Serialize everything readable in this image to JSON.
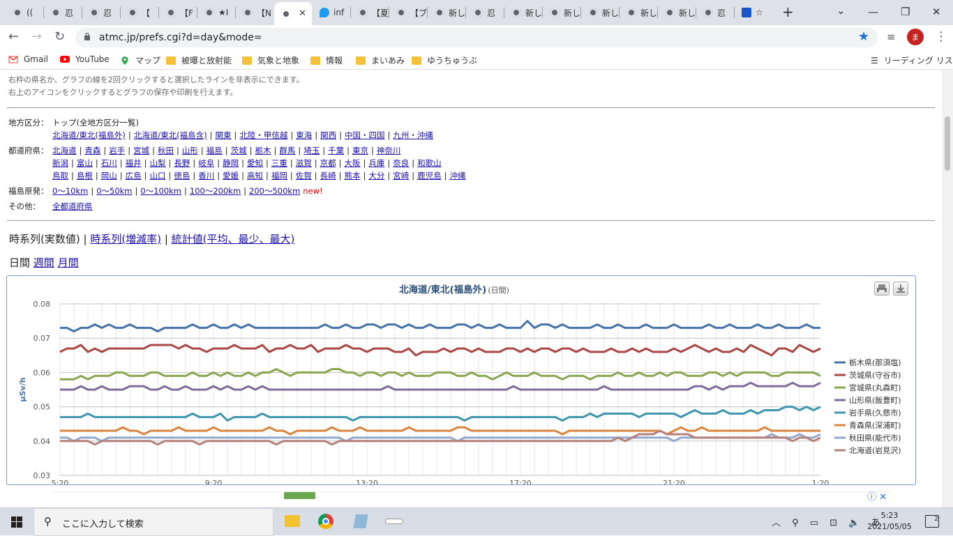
{
  "browser": {
    "tabs": [
      {
        "label": "(("
      },
      {
        "label": "忍"
      },
      {
        "label": "忍"
      },
      {
        "label": "【"
      },
      {
        "label": "【F"
      },
      {
        "label": "★I"
      },
      {
        "label": "【N"
      },
      {
        "label": "",
        "active": true
      },
      {
        "label": "inf"
      },
      {
        "label": "【夏"
      },
      {
        "label": "【ブ"
      },
      {
        "label": "新しいタ"
      },
      {
        "label": "忍"
      },
      {
        "label": "新しいタ"
      },
      {
        "label": "新しいタ"
      },
      {
        "label": "新しいタ"
      },
      {
        "label": "新しいタ"
      },
      {
        "label": "新しいタ"
      },
      {
        "label": "忍"
      },
      {
        "label": "☆"
      }
    ],
    "url": "atmc.jp/prefs.cgi?d=day&mode=",
    "avatar": "ま",
    "bookmarks": [
      {
        "label": "Gmail",
        "icon": "gmail-icon"
      },
      {
        "label": "YouTube",
        "icon": "youtube-icon"
      },
      {
        "label": "マップ",
        "icon": "maps-icon"
      },
      {
        "label": "被曝と放射能",
        "icon": "folder-icon"
      },
      {
        "label": "気象と地象",
        "icon": "folder-icon"
      },
      {
        "label": "情報",
        "icon": "folder-icon"
      },
      {
        "label": "まいあみ",
        "icon": "folder-icon"
      },
      {
        "label": "ゆうちゅうぶ",
        "icon": "folder-icon"
      }
    ],
    "reading_list": "リーディング リスト"
  },
  "page": {
    "note1": "右枠の県名か、グラフの線を2回クリックすると選択したラインを非表示にできます。",
    "note2": "右上のアイコンをクリックするとグラフの保存や印刷を行えます。",
    "region_label": "地方区分：",
    "region_top": "トップ(全地方区分一覧)",
    "regions": [
      "北海道/東北(福島外)",
      "北海道/東北(福島含)",
      "関東",
      "北陸・甲信越",
      "東海",
      "関西",
      "中国・四国",
      "九州・沖縄"
    ],
    "pref_label": "都道府県：",
    "prefs_row1": [
      "北海道",
      "青森",
      "岩手",
      "宮城",
      "秋田",
      "山形",
      "福島",
      "茨城",
      "栃木",
      "群馬",
      "埼玉",
      "千葉",
      "東京",
      "神奈川"
    ],
    "prefs_row2": [
      "新潟",
      "富山",
      "石川",
      "福井",
      "山梨",
      "長野",
      "岐阜",
      "静岡",
      "愛知",
      "三重",
      "滋賀",
      "京都",
      "大阪",
      "兵庫",
      "奈良",
      "和歌山"
    ],
    "prefs_row3": [
      "鳥取",
      "島根",
      "岡山",
      "広島",
      "山口",
      "徳島",
      "香川",
      "愛媛",
      "高知",
      "福岡",
      "佐賀",
      "長崎",
      "熊本",
      "大分",
      "宮崎",
      "鹿児島",
      "沖縄"
    ],
    "fukushima_label": "福島原発：",
    "fukushima": [
      "0〜10km",
      "0〜50km",
      "0〜100km",
      "100〜200km",
      "200〜500km"
    ],
    "new_badge": "new!",
    "other_label": "その他：",
    "other_link": "全都道府県",
    "mode_current": "時系列(実数値)",
    "mode_links": [
      "時系列(増減率)",
      "統計値(平均、最少、最大)"
    ],
    "period_current": "日間",
    "period_links": [
      "週間",
      "月間"
    ]
  },
  "chart_data": {
    "type": "line",
    "title": "北海道/東北(福島外)",
    "subtitle": "(日間)",
    "ylabel": "μSv/h",
    "ylim": [
      0.03,
      0.08
    ],
    "yticks": [
      "0.08",
      "0.07",
      "0.06",
      "0.05",
      "0.04",
      "0.03"
    ],
    "x_tick_labels": [
      "5:20",
      "9:20",
      "13:20",
      "17:20",
      "21:20",
      "1:20"
    ],
    "legend_position": "right",
    "grid": true,
    "series": [
      {
        "name": "栃木県(那須塩)",
        "color": "#4572a7",
        "values": [
          0.073,
          0.073,
          0.072,
          0.073,
          0.073,
          0.074,
          0.073,
          0.074,
          0.073,
          0.073,
          0.074,
          0.073,
          0.073,
          0.073,
          0.072,
          0.073,
          0.073,
          0.073,
          0.073,
          0.074,
          0.073,
          0.073,
          0.074,
          0.073,
          0.073,
          0.074,
          0.073,
          0.074,
          0.073,
          0.073,
          0.073,
          0.073,
          0.073,
          0.073,
          0.073,
          0.073,
          0.073,
          0.073,
          0.074,
          0.073,
          0.073,
          0.074,
          0.073,
          0.073,
          0.074,
          0.074,
          0.073,
          0.074,
          0.074,
          0.073,
          0.074,
          0.073,
          0.073,
          0.074,
          0.073,
          0.073,
          0.073,
          0.074,
          0.074,
          0.073,
          0.074,
          0.073,
          0.073,
          0.074,
          0.073,
          0.073,
          0.073,
          0.075,
          0.073,
          0.074,
          0.074,
          0.073,
          0.074,
          0.073,
          0.073,
          0.073,
          0.073,
          0.074,
          0.073,
          0.073,
          0.074,
          0.073,
          0.073,
          0.073,
          0.074,
          0.073,
          0.073,
          0.073,
          0.074,
          0.073,
          0.073,
          0.073,
          0.073,
          0.074,
          0.073,
          0.073,
          0.074,
          0.073,
          0.073,
          0.073,
          0.074,
          0.073,
          0.073,
          0.074,
          0.073,
          0.073,
          0.073,
          0.074,
          0.073,
          0.073
        ]
      },
      {
        "name": "茨城県(守谷市)",
        "color": "#aa4643",
        "values": [
          0.066,
          0.067,
          0.067,
          0.068,
          0.066,
          0.067,
          0.066,
          0.067,
          0.067,
          0.067,
          0.067,
          0.067,
          0.067,
          0.068,
          0.068,
          0.068,
          0.068,
          0.067,
          0.068,
          0.067,
          0.067,
          0.066,
          0.067,
          0.067,
          0.067,
          0.068,
          0.067,
          0.067,
          0.067,
          0.068,
          0.066,
          0.067,
          0.067,
          0.068,
          0.067,
          0.067,
          0.068,
          0.066,
          0.067,
          0.067,
          0.067,
          0.068,
          0.067,
          0.067,
          0.066,
          0.067,
          0.067,
          0.067,
          0.066,
          0.066,
          0.067,
          0.065,
          0.066,
          0.066,
          0.066,
          0.067,
          0.066,
          0.067,
          0.067,
          0.066,
          0.067,
          0.066,
          0.066,
          0.066,
          0.067,
          0.067,
          0.066,
          0.067,
          0.066,
          0.067,
          0.067,
          0.066,
          0.067,
          0.067,
          0.066,
          0.067,
          0.066,
          0.066,
          0.066,
          0.067,
          0.066,
          0.066,
          0.067,
          0.066,
          0.067,
          0.066,
          0.066,
          0.066,
          0.067,
          0.066,
          0.067,
          0.068,
          0.067,
          0.066,
          0.067,
          0.066,
          0.066,
          0.067,
          0.066,
          0.068,
          0.067,
          0.066,
          0.065,
          0.067,
          0.067,
          0.066,
          0.068,
          0.067,
          0.066,
          0.067
        ]
      },
      {
        "name": "宮城県(丸森町)",
        "color": "#89a54e",
        "values": [
          0.058,
          0.058,
          0.058,
          0.059,
          0.058,
          0.059,
          0.059,
          0.059,
          0.06,
          0.06,
          0.059,
          0.059,
          0.059,
          0.06,
          0.06,
          0.059,
          0.059,
          0.059,
          0.059,
          0.06,
          0.059,
          0.059,
          0.06,
          0.059,
          0.06,
          0.059,
          0.059,
          0.06,
          0.059,
          0.06,
          0.06,
          0.061,
          0.06,
          0.059,
          0.06,
          0.06,
          0.06,
          0.06,
          0.06,
          0.061,
          0.061,
          0.06,
          0.06,
          0.059,
          0.06,
          0.06,
          0.059,
          0.06,
          0.06,
          0.059,
          0.06,
          0.059,
          0.059,
          0.059,
          0.06,
          0.06,
          0.06,
          0.059,
          0.059,
          0.06,
          0.059,
          0.059,
          0.058,
          0.059,
          0.06,
          0.059,
          0.059,
          0.059,
          0.06,
          0.059,
          0.059,
          0.059,
          0.058,
          0.059,
          0.059,
          0.059,
          0.058,
          0.059,
          0.059,
          0.059,
          0.06,
          0.059,
          0.059,
          0.06,
          0.059,
          0.059,
          0.06,
          0.059,
          0.06,
          0.06,
          0.059,
          0.059,
          0.059,
          0.06,
          0.06,
          0.059,
          0.06,
          0.059,
          0.06,
          0.06,
          0.06,
          0.06,
          0.059,
          0.059,
          0.06,
          0.06,
          0.06,
          0.06,
          0.06,
          0.059
        ]
      },
      {
        "name": "山形県(飯豊町)",
        "color": "#80699b",
        "values": [
          0.055,
          0.055,
          0.055,
          0.056,
          0.055,
          0.055,
          0.056,
          0.055,
          0.055,
          0.055,
          0.056,
          0.056,
          0.056,
          0.055,
          0.055,
          0.056,
          0.055,
          0.055,
          0.056,
          0.055,
          0.055,
          0.055,
          0.056,
          0.055,
          0.056,
          0.055,
          0.055,
          0.056,
          0.055,
          0.056,
          0.055,
          0.055,
          0.055,
          0.055,
          0.055,
          0.055,
          0.055,
          0.055,
          0.055,
          0.055,
          0.055,
          0.055,
          0.055,
          0.055,
          0.055,
          0.055,
          0.055,
          0.056,
          0.055,
          0.055,
          0.055,
          0.055,
          0.055,
          0.055,
          0.055,
          0.055,
          0.055,
          0.055,
          0.055,
          0.055,
          0.055,
          0.055,
          0.055,
          0.055,
          0.055,
          0.056,
          0.055,
          0.055,
          0.055,
          0.055,
          0.055,
          0.055,
          0.055,
          0.055,
          0.055,
          0.055,
          0.055,
          0.055,
          0.056,
          0.055,
          0.055,
          0.055,
          0.055,
          0.055,
          0.055,
          0.055,
          0.055,
          0.055,
          0.055,
          0.055,
          0.055,
          0.056,
          0.056,
          0.055,
          0.056,
          0.055,
          0.056,
          0.056,
          0.056,
          0.057,
          0.056,
          0.056,
          0.056,
          0.056,
          0.056,
          0.057,
          0.056,
          0.056,
          0.056,
          0.057
        ]
      },
      {
        "name": "岩手県(久慈市)",
        "color": "#3d96ae",
        "values": [
          0.047,
          0.047,
          0.047,
          0.047,
          0.048,
          0.047,
          0.047,
          0.047,
          0.047,
          0.047,
          0.047,
          0.047,
          0.047,
          0.047,
          0.047,
          0.047,
          0.047,
          0.047,
          0.047,
          0.048,
          0.047,
          0.047,
          0.047,
          0.048,
          0.046,
          0.047,
          0.047,
          0.047,
          0.047,
          0.048,
          0.047,
          0.047,
          0.047,
          0.047,
          0.047,
          0.047,
          0.047,
          0.047,
          0.047,
          0.047,
          0.047,
          0.047,
          0.046,
          0.047,
          0.047,
          0.047,
          0.047,
          0.047,
          0.047,
          0.047,
          0.047,
          0.047,
          0.047,
          0.047,
          0.047,
          0.047,
          0.047,
          0.047,
          0.046,
          0.047,
          0.047,
          0.047,
          0.047,
          0.047,
          0.047,
          0.047,
          0.047,
          0.047,
          0.047,
          0.047,
          0.047,
          0.047,
          0.046,
          0.047,
          0.047,
          0.047,
          0.048,
          0.047,
          0.048,
          0.048,
          0.048,
          0.048,
          0.048,
          0.047,
          0.048,
          0.048,
          0.048,
          0.048,
          0.048,
          0.047,
          0.048,
          0.049,
          0.048,
          0.048,
          0.048,
          0.049,
          0.048,
          0.048,
          0.048,
          0.049,
          0.048,
          0.049,
          0.049,
          0.049,
          0.05,
          0.05,
          0.049,
          0.05,
          0.049,
          0.05
        ]
      },
      {
        "name": "青森県(深浦町)",
        "color": "#db843d",
        "values": [
          0.043,
          0.043,
          0.043,
          0.043,
          0.043,
          0.043,
          0.043,
          0.043,
          0.043,
          0.044,
          0.043,
          0.043,
          0.042,
          0.043,
          0.043,
          0.043,
          0.043,
          0.044,
          0.043,
          0.043,
          0.043,
          0.043,
          0.044,
          0.043,
          0.043,
          0.043,
          0.043,
          0.043,
          0.043,
          0.043,
          0.044,
          0.043,
          0.043,
          0.042,
          0.043,
          0.043,
          0.043,
          0.043,
          0.043,
          0.044,
          0.043,
          0.043,
          0.043,
          0.044,
          0.043,
          0.043,
          0.043,
          0.043,
          0.043,
          0.043,
          0.044,
          0.043,
          0.043,
          0.043,
          0.043,
          0.043,
          0.043,
          0.044,
          0.044,
          0.043,
          0.043,
          0.043,
          0.043,
          0.043,
          0.043,
          0.043,
          0.043,
          0.043,
          0.043,
          0.043,
          0.043,
          0.043,
          0.042,
          0.043,
          0.043,
          0.043,
          0.043,
          0.043,
          0.043,
          0.043,
          0.043,
          0.043,
          0.043,
          0.043,
          0.043,
          0.043,
          0.043,
          0.042,
          0.043,
          0.044,
          0.043,
          0.043,
          0.044,
          0.043,
          0.043,
          0.043,
          0.043,
          0.043,
          0.043,
          0.043,
          0.043,
          0.044,
          0.043,
          0.043,
          0.043,
          0.043,
          0.043,
          0.043,
          0.043,
          0.043
        ]
      },
      {
        "name": "秋田県(能代市)",
        "color": "#92a8cd",
        "values": [
          0.041,
          0.041,
          0.04,
          0.041,
          0.041,
          0.041,
          0.04,
          0.041,
          0.041,
          0.041,
          0.041,
          0.041,
          0.041,
          0.041,
          0.041,
          0.041,
          0.041,
          0.041,
          0.041,
          0.041,
          0.041,
          0.041,
          0.041,
          0.041,
          0.041,
          0.041,
          0.041,
          0.041,
          0.041,
          0.041,
          0.041,
          0.041,
          0.041,
          0.041,
          0.041,
          0.041,
          0.041,
          0.041,
          0.041,
          0.041,
          0.041,
          0.04,
          0.041,
          0.041,
          0.041,
          0.041,
          0.041,
          0.041,
          0.041,
          0.041,
          0.041,
          0.041,
          0.041,
          0.041,
          0.041,
          0.041,
          0.041,
          0.04,
          0.041,
          0.041,
          0.041,
          0.041,
          0.041,
          0.041,
          0.041,
          0.041,
          0.041,
          0.041,
          0.041,
          0.041,
          0.041,
          0.041,
          0.041,
          0.041,
          0.041,
          0.041,
          0.041,
          0.041,
          0.041,
          0.041,
          0.041,
          0.041,
          0.041,
          0.041,
          0.041,
          0.041,
          0.041,
          0.041,
          0.04,
          0.041,
          0.041,
          0.041,
          0.041,
          0.041,
          0.041,
          0.041,
          0.041,
          0.041,
          0.041,
          0.041,
          0.041,
          0.041,
          0.042,
          0.041,
          0.041,
          0.041,
          0.042,
          0.041,
          0.041,
          0.042
        ]
      },
      {
        "name": "北海道(岩見沢)",
        "color": "#b5807a",
        "values": [
          0.04,
          0.04,
          0.04,
          0.04,
          0.04,
          0.039,
          0.04,
          0.04,
          0.04,
          0.04,
          0.04,
          0.04,
          0.04,
          0.04,
          0.039,
          0.04,
          0.04,
          0.04,
          0.04,
          0.04,
          0.039,
          0.04,
          0.04,
          0.04,
          0.04,
          0.04,
          0.04,
          0.04,
          0.04,
          0.04,
          0.04,
          0.039,
          0.04,
          0.04,
          0.04,
          0.04,
          0.04,
          0.04,
          0.04,
          0.039,
          0.04,
          0.04,
          0.04,
          0.04,
          0.04,
          0.04,
          0.04,
          0.04,
          0.04,
          0.04,
          0.04,
          0.04,
          0.04,
          0.04,
          0.04,
          0.04,
          0.04,
          0.04,
          0.04,
          0.04,
          0.04,
          0.04,
          0.04,
          0.04,
          0.04,
          0.04,
          0.04,
          0.04,
          0.04,
          0.04,
          0.04,
          0.04,
          0.04,
          0.04,
          0.04,
          0.04,
          0.04,
          0.04,
          0.04,
          0.04,
          0.041,
          0.04,
          0.041,
          0.042,
          0.042,
          0.042,
          0.043,
          0.042,
          0.042,
          0.042,
          0.042,
          0.041,
          0.041,
          0.041,
          0.041,
          0.041,
          0.041,
          0.041,
          0.041,
          0.041,
          0.041,
          0.041,
          0.041,
          0.041,
          0.041,
          0.04,
          0.041,
          0.041,
          0.04,
          0.041
        ]
      }
    ]
  },
  "taskbar": {
    "search_placeholder": "ここに入力して検索",
    "time": "5:23",
    "date": "2021/05/05",
    "notifications": "2"
  }
}
